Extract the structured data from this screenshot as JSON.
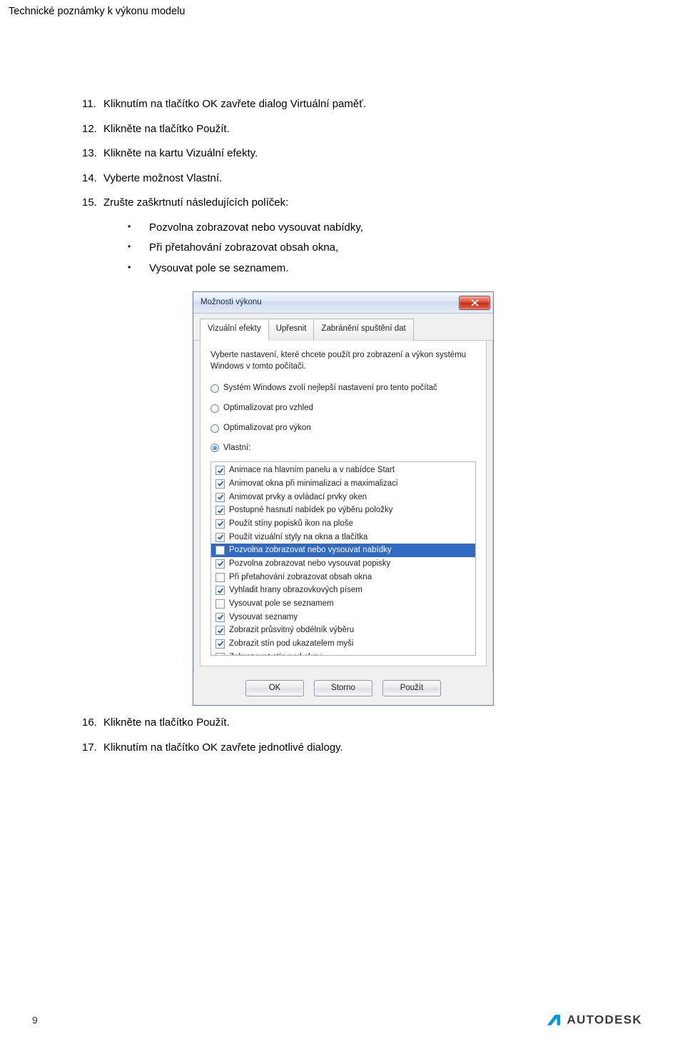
{
  "page": {
    "header": "Technické poznámky k výkonu modelu",
    "page_number": "9",
    "footer_logo_text": "AUTODESK"
  },
  "steps_a": [
    {
      "n": "11.",
      "t": "Kliknutím na tlačítko OK zavřete dialog Virtuální paměť."
    },
    {
      "n": "12.",
      "t": "Klikněte na tlačítko Použít."
    },
    {
      "n": "13.",
      "t": "Klikněte na kartu Vizuální efekty."
    },
    {
      "n": "14.",
      "t": "Vyberte možnost Vlastní."
    },
    {
      "n": "15.",
      "t": "Zrušte zaškrtnutí následujících políček:"
    }
  ],
  "bullets": [
    "Pozvolna zobrazovat nebo vysouvat nabídky,",
    "Při přetahování zobrazovat obsah okna,",
    "Vysouvat pole se seznamem."
  ],
  "steps_b": [
    {
      "n": "16.",
      "t": "Klikněte na tlačítko Použít."
    },
    {
      "n": "17.",
      "t": "Kliknutím na tlačítko OK zavřete jednotlivé dialogy."
    }
  ],
  "dialog": {
    "title": "Možnosti výkonu",
    "tabs": [
      "Vizuální efekty",
      "Upřesnit",
      "Zabránění spuštění dat"
    ],
    "intro": "Vyberte nastavení, které chcete použít pro zobrazení a výkon systému Windows v tomto počítači.",
    "radios": [
      {
        "label": "Systém Windows zvolí nejlepší nastavení pro tento počítač",
        "selected": false
      },
      {
        "label": "Optimalizovat pro vzhled",
        "selected": false
      },
      {
        "label": "Optimalizovat pro výkon",
        "selected": false
      },
      {
        "label": "Vlastní:",
        "selected": true
      }
    ],
    "checks": [
      {
        "label": "Animace na hlavním panelu a v nabídce Start",
        "checked": true,
        "selected": false
      },
      {
        "label": "Animovat okna při minimalizaci a maximalizaci",
        "checked": true,
        "selected": false
      },
      {
        "label": "Animovat prvky a ovládací prvky oken",
        "checked": true,
        "selected": false
      },
      {
        "label": "Postupné hasnutí nabídek po výběru položky",
        "checked": true,
        "selected": false
      },
      {
        "label": "Použít stíny popisků ikon na ploše",
        "checked": true,
        "selected": false
      },
      {
        "label": "Použít vizuální styly na okna a tlačítka",
        "checked": true,
        "selected": false
      },
      {
        "label": "Pozvolna zobrazovat nebo vysouvat nabídky",
        "checked": false,
        "selected": true
      },
      {
        "label": "Pozvolna zobrazovat nebo vysouvat popisky",
        "checked": true,
        "selected": false
      },
      {
        "label": "Při přetahování zobrazovat obsah okna",
        "checked": false,
        "selected": false
      },
      {
        "label": "Vyhladit hrany obrazovkových písem",
        "checked": true,
        "selected": false
      },
      {
        "label": "Vysouvat pole se seznamem",
        "checked": false,
        "selected": false
      },
      {
        "label": "Vysouvat seznamy",
        "checked": true,
        "selected": false
      },
      {
        "label": "Zobrazit průsvitný obdélník výběru",
        "checked": true,
        "selected": false
      },
      {
        "label": "Zobrazit stín pod ukazatelem myši",
        "checked": true,
        "selected": false
      },
      {
        "label": "Zobrazovat stín pod okny",
        "checked": true,
        "selected": false
      }
    ],
    "buttons": {
      "ok": "OK",
      "cancel": "Storno",
      "apply": "Použít"
    }
  }
}
